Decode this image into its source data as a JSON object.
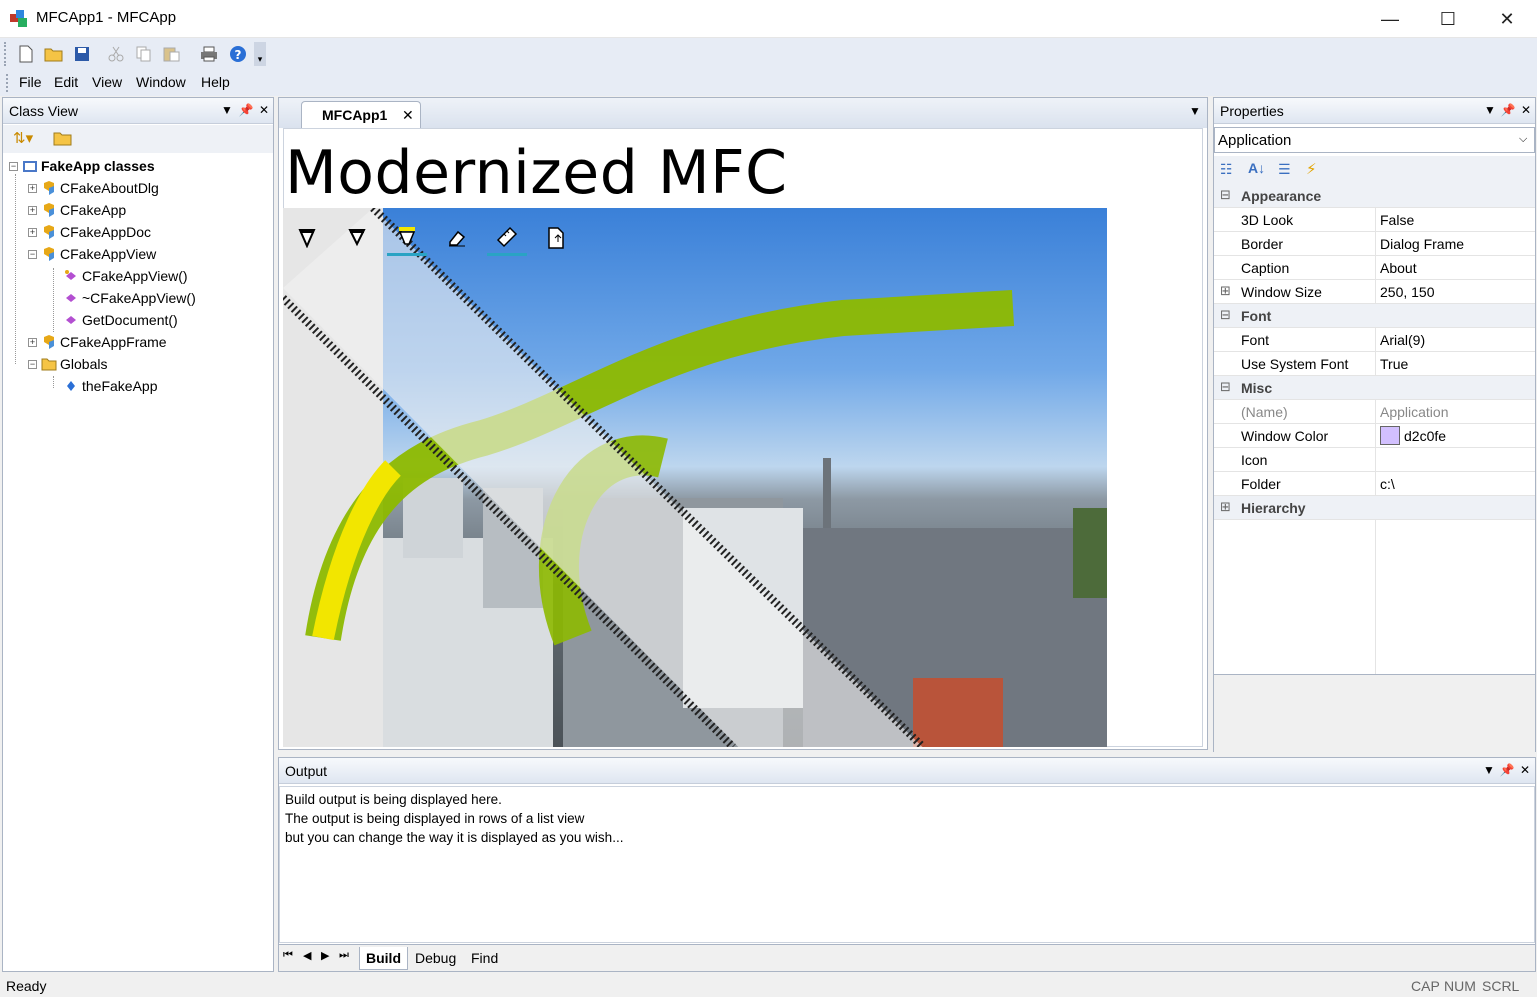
{
  "window": {
    "title": "MFCApp1 - MFCApp",
    "minimize": "—",
    "maximize": "☐",
    "close": "✕"
  },
  "menu": [
    "File",
    "Edit",
    "View",
    "Window",
    "Help"
  ],
  "toolbar_icons": [
    "new-icon",
    "open-icon",
    "save-icon",
    "cut-icon",
    "copy-icon",
    "paste-icon",
    "print-icon",
    "help-icon"
  ],
  "class_view": {
    "title": "Class View",
    "root": "FakeApp classes",
    "items": [
      "CFakeAboutDlg",
      "CFakeApp",
      "CFakeAppDoc",
      "CFakeAppView",
      "CFakeAppView()",
      "~CFakeAppView()",
      "GetDocument()",
      "CFakeAppFrame",
      "Globals",
      "theFakeApp"
    ]
  },
  "document": {
    "tab": "MFCApp1",
    "heading": "Modernized MFC",
    "ink_tools": [
      "ballpoint-pen-icon",
      "pencil-icon",
      "highlighter-icon",
      "eraser-icon",
      "ruler-icon",
      "export-icon"
    ]
  },
  "properties": {
    "title": "Properties",
    "object": "Application",
    "rows": [
      {
        "cat": true,
        "name": "Appearance",
        "sign": "⊟"
      },
      {
        "name": "3D Look",
        "value": "False"
      },
      {
        "name": "Border",
        "value": "Dialog Frame"
      },
      {
        "name": "Caption",
        "value": "About"
      },
      {
        "name": "Window Size",
        "value": "250, 150",
        "sign": "⊞"
      },
      {
        "cat": true,
        "name": "Font",
        "sign": "⊟"
      },
      {
        "name": "Font",
        "value": "Arial(9)"
      },
      {
        "name": "Use System Font",
        "value": "True"
      },
      {
        "cat": true,
        "name": "Misc",
        "sign": "⊟"
      },
      {
        "name": "(Name)",
        "value": "Application",
        "disabled": true
      },
      {
        "name": "Window Color",
        "value": "d2c0fe",
        "swatch": "#d2c0fe"
      },
      {
        "name": "Icon",
        "value": ""
      },
      {
        "name": "Folder",
        "value": "c:\\"
      },
      {
        "cat": true,
        "name": "Hierarchy",
        "sign": "⊞"
      }
    ]
  },
  "output": {
    "title": "Output",
    "lines": [
      "Build output is being displayed here.",
      "The output is being displayed in rows of a list view",
      "but you can change the way it is displayed as you wish..."
    ],
    "tabs": [
      "Build",
      "Debug",
      "Find"
    ]
  },
  "status": {
    "text": "Ready",
    "indicators": [
      "CAP",
      "NUM",
      "SCRL"
    ]
  }
}
